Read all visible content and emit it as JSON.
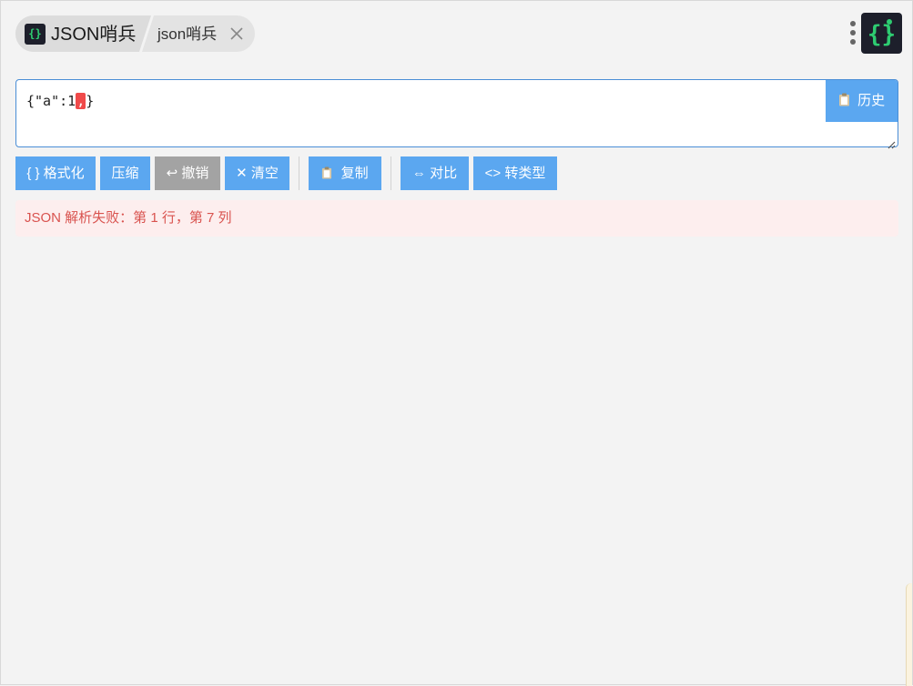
{
  "header": {
    "tabs": [
      {
        "label": "JSON哨兵",
        "logo_text": "{}"
      },
      {
        "label": "json哨兵"
      }
    ]
  },
  "editor": {
    "value_before": "{\"a\":1",
    "error_char": ",",
    "value_after": "}",
    "history_label": "历史"
  },
  "toolbar": {
    "format_label": "{ } 格式化",
    "compress_label": "压缩",
    "undo_label": "↩ 撤销",
    "clear_label": "✕ 清空",
    "copy_label": "复制",
    "compare_label": "⇔ 对比",
    "convert_label": "<> 转类型"
  },
  "error": {
    "message": "JSON 解析失败：第 1 行，第 7 列"
  },
  "colors": {
    "accent": "#5ba7f0",
    "disabled": "#a3a3a3",
    "error_text": "#d9534f",
    "error_bg": "#fdeeee",
    "logo_bg": "#1d1f2b",
    "logo_brace": "#2ecc71"
  },
  "icons": [
    "app-logo-icon",
    "close-icon",
    "more-vertical-icon",
    "clipboard-icon",
    "resize-grip-icon"
  ]
}
